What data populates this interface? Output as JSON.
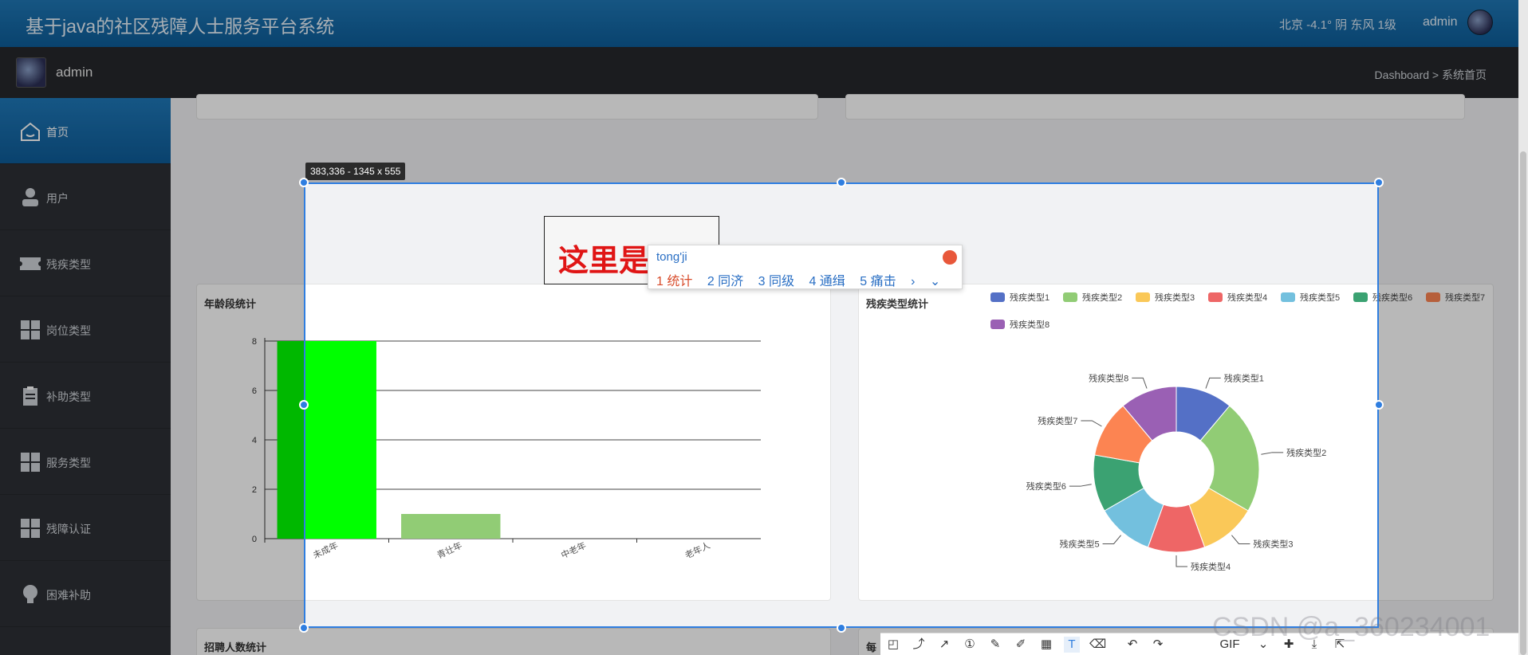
{
  "header": {
    "title": "基于java的社区残障人士服务平台系统",
    "weather": "北京  -4.1°  阴  东风  1级",
    "username": "admin"
  },
  "subbar": {
    "username": "admin",
    "breadcrumb": "Dashboard > 系统首页"
  },
  "sidebar": {
    "items": [
      {
        "label": "首页",
        "icon": "home-icon"
      },
      {
        "label": "用户",
        "icon": "user-icon"
      },
      {
        "label": "残疾类型",
        "icon": "ticket-icon"
      },
      {
        "label": "岗位类型",
        "icon": "grid-icon"
      },
      {
        "label": "补助类型",
        "icon": "clipboard-icon"
      },
      {
        "label": "服务类型",
        "icon": "grid-icon"
      },
      {
        "label": "残障认证",
        "icon": "grid-icon"
      },
      {
        "label": "困难补助",
        "icon": "bulb-icon"
      }
    ]
  },
  "cards": {
    "age_title": "年龄段统计",
    "disability_title": "残疾类型统计",
    "recruit_title": "招聘人数统计",
    "bottom_right_title": "每"
  },
  "chart_data": [
    {
      "type": "bar",
      "title": "年龄段统计",
      "categories": [
        "未成年",
        "青壮年",
        "中老年",
        "老年人"
      ],
      "values": [
        8,
        1,
        0,
        0
      ],
      "ylim": [
        0,
        8
      ],
      "yticks": [
        "0",
        "2",
        "4",
        "6",
        "8"
      ],
      "colors": [
        "#00ff00",
        "#91cc75"
      ]
    },
    {
      "type": "pie",
      "title": "残疾类型统计",
      "categories": [
        "残疾类型1",
        "残疾类型2",
        "残疾类型3",
        "残疾类型4",
        "残疾类型5",
        "残疾类型6",
        "残疾类型7",
        "残疾类型8"
      ],
      "values": [
        1,
        2,
        1,
        1,
        1,
        1,
        1,
        1
      ],
      "colors": [
        "#5470c6",
        "#91cc75",
        "#fac858",
        "#ee6666",
        "#73c0de",
        "#3ba272",
        "#fc8452",
        "#9a60b4"
      ],
      "legend_position": "top"
    }
  ],
  "screenshot": {
    "tooltip": "383,336 - 1345 x 555",
    "overlay_text": "这里是主页"
  },
  "ime": {
    "pinyin": "tong'ji",
    "candidates": [
      "1 统计",
      "2 同济",
      "3 同级",
      "4 通缉",
      "5 痛击"
    ]
  },
  "toolbar": {
    "gif": "GIF"
  },
  "watermark": "CSDN @a_360234001"
}
